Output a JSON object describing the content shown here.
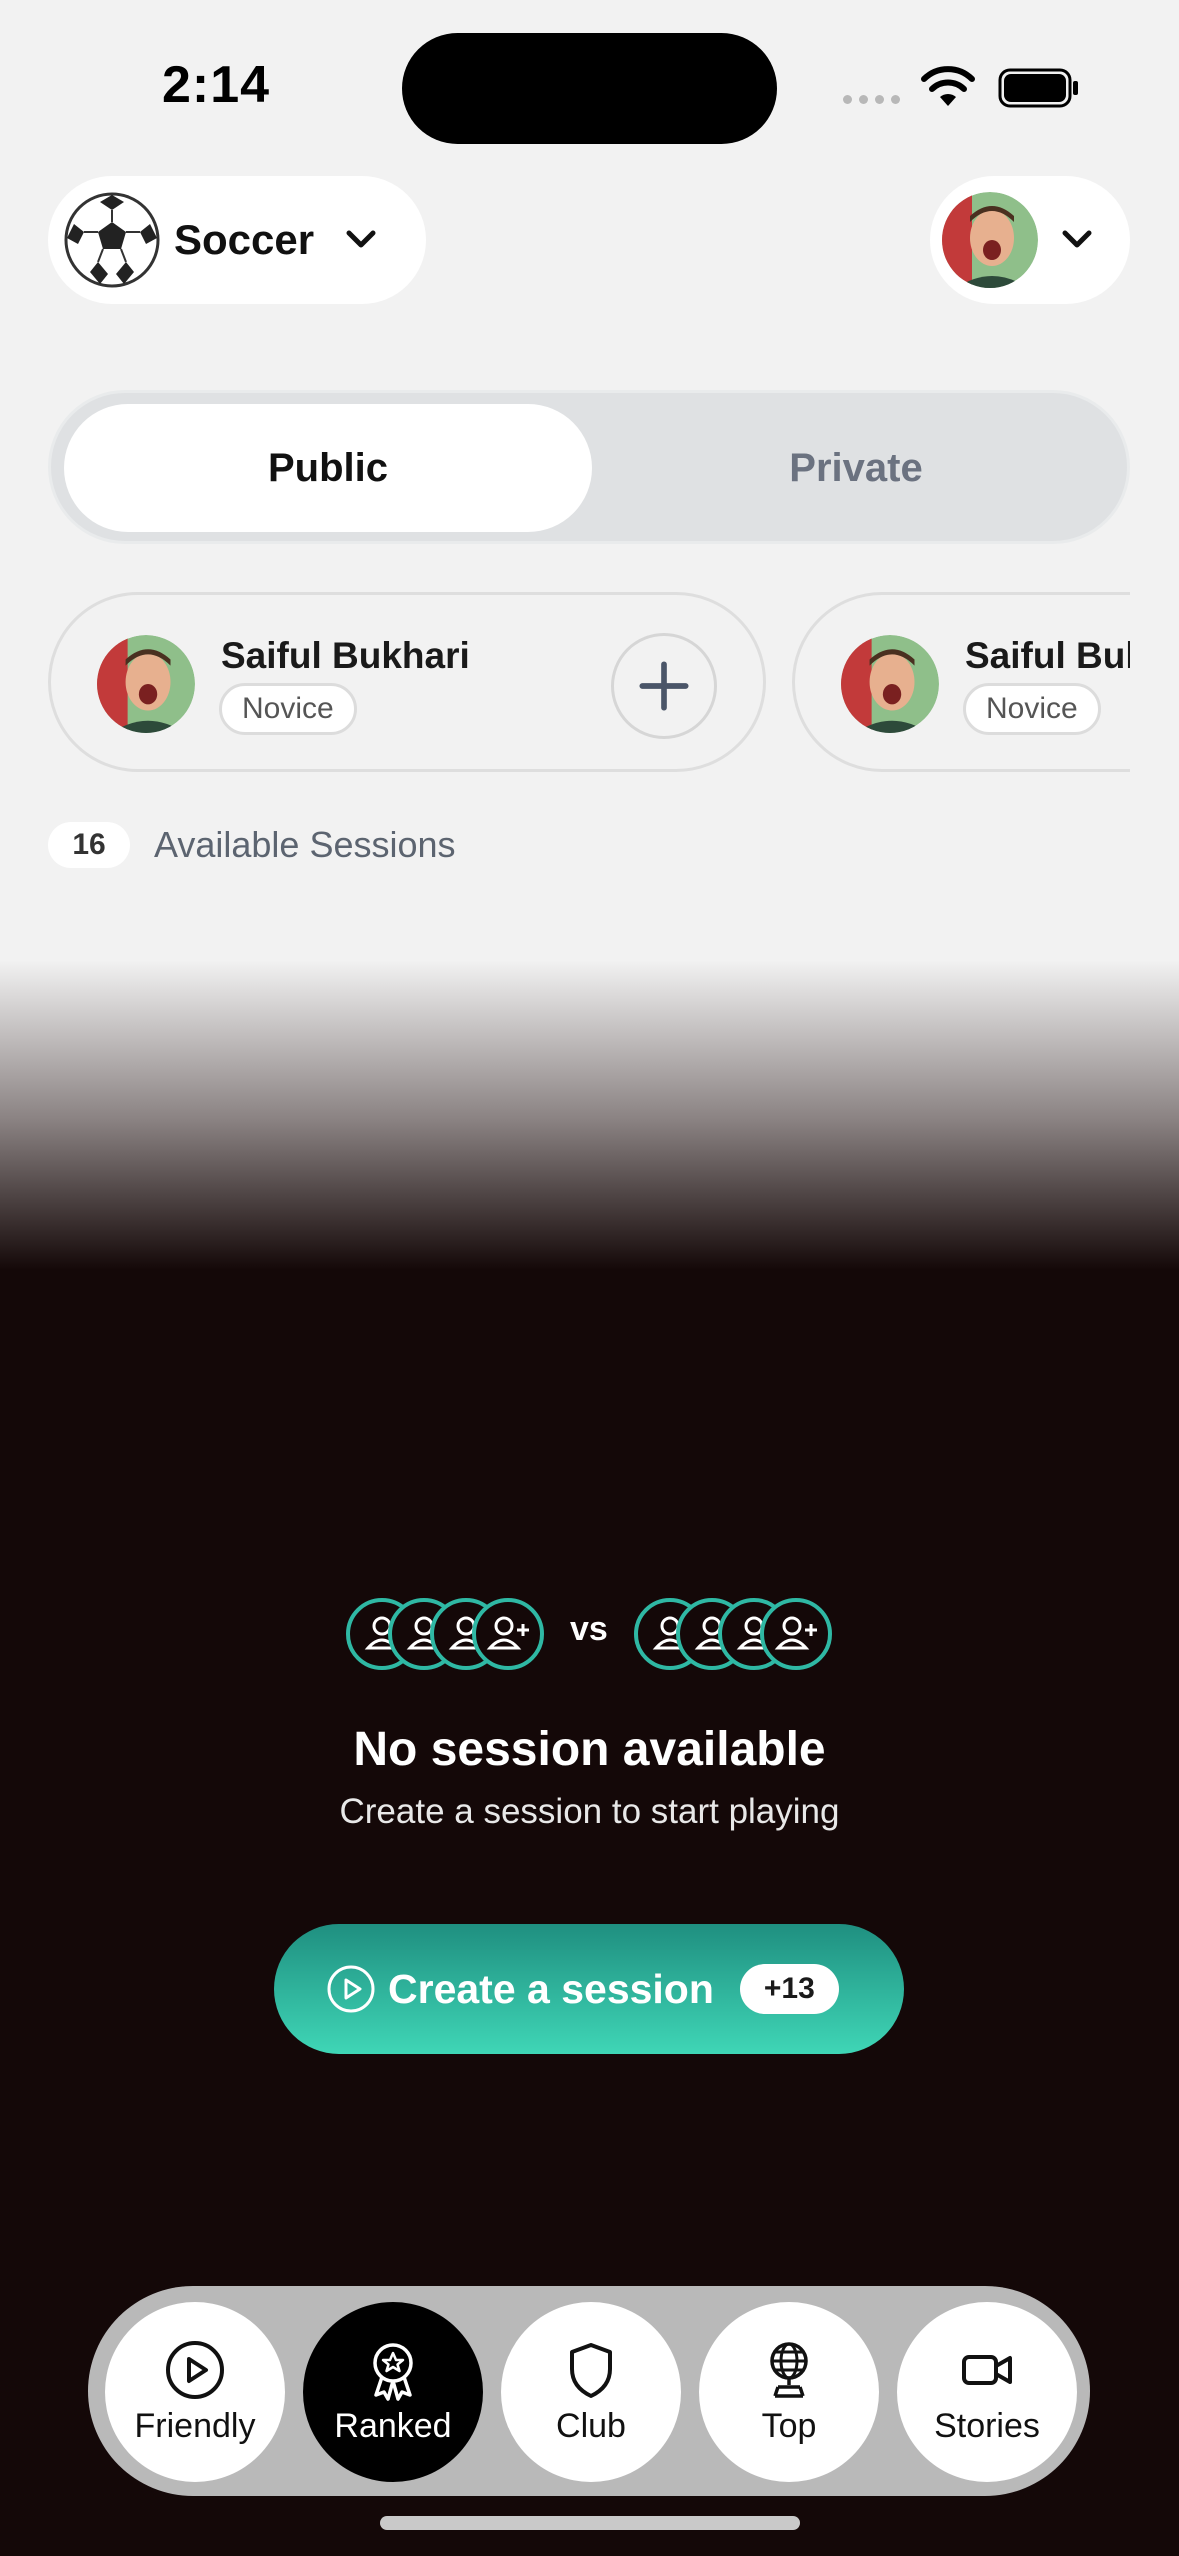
{
  "status_bar": {
    "time": "2:14"
  },
  "header": {
    "sport": {
      "label": "Soccer",
      "icon": "soccer-ball-icon"
    },
    "profile": {
      "icon": "chevron-down-icon"
    }
  },
  "visibility_toggle": {
    "options": [
      "Public",
      "Private"
    ],
    "selected": "Public"
  },
  "players": [
    {
      "name": "Saiful Bukhari",
      "level": "Novice"
    },
    {
      "name": "Saiful Bukhari",
      "level": "Novice"
    }
  ],
  "sessions": {
    "count": "16",
    "label": "Available Sessions"
  },
  "empty_state": {
    "vs": "vs",
    "title": "No session available",
    "subtitle": "Create a session to start playing"
  },
  "create_button": {
    "label": "Create a session",
    "badge": "+13"
  },
  "tabs": [
    {
      "label": "Friendly",
      "icon": "play-circle-icon",
      "active": false
    },
    {
      "label": "Ranked",
      "icon": "award-ribbon-icon",
      "active": true
    },
    {
      "label": "Club",
      "icon": "shield-icon",
      "active": false
    },
    {
      "label": "Top",
      "icon": "globe-trophy-icon",
      "active": false
    },
    {
      "label": "Stories",
      "icon": "video-camera-icon",
      "active": false
    }
  ],
  "colors": {
    "accent": "#3fd6b6",
    "dark_bg": "#140808",
    "light_bg": "#f2f2f2"
  }
}
